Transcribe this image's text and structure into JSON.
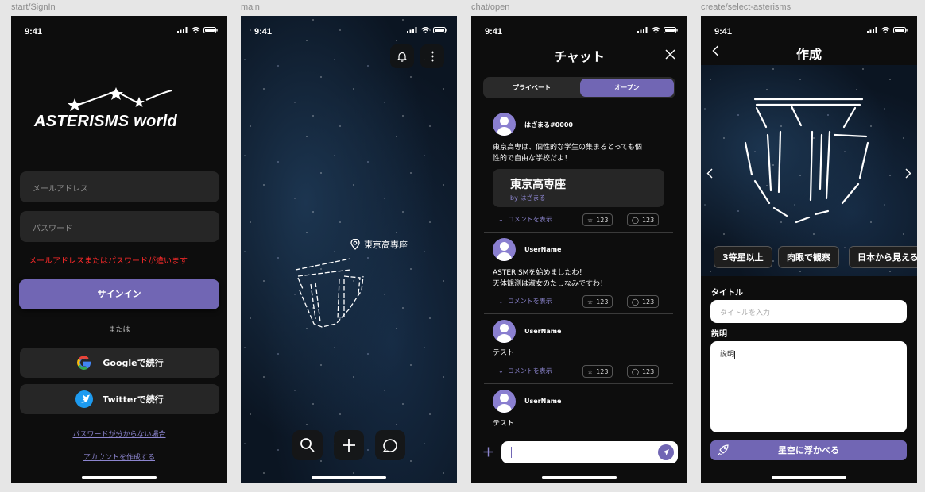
{
  "frames": [
    {
      "label": "start/SignIn"
    },
    {
      "label": "main"
    },
    {
      "label": "chat/open"
    },
    {
      "label": "create/select-asterisms"
    }
  ],
  "status_time": "9:41",
  "signin": {
    "logo_text": "ASTERISMS world",
    "email_placeholder": "メールアドレス",
    "password_placeholder": "パスワード",
    "error_text": "メールアドレスまたはパスワードが違います",
    "signin_label": "サインイン",
    "or_text": "または",
    "google_label": "Googleで続行",
    "twitter_label": "Twitterで続行",
    "forgot_link": "パスワードが分からない場合",
    "create_account_link": "アカウントを作成する"
  },
  "main": {
    "place_name": "東京高専座"
  },
  "chat": {
    "title": "チャット",
    "tabs": [
      "プライベート",
      "オープン"
    ],
    "active_tab": "オープン",
    "posts": [
      {
        "user": "はざまる#0000",
        "text_lines": [
          "東京高専は、個性的な学生の集まるとっても個",
          "性的で自由な学校だよ！"
        ],
        "card_title": "東京高専座",
        "card_by": "by はざまる",
        "comment_label": "コメントを表示",
        "stars": "123",
        "comments": "123"
      },
      {
        "user": "UserName",
        "text_lines": [
          "ASTERISMを始めましたわ！",
          "天体観測は淑女のたしなみですわ！"
        ],
        "comment_label": "コメントを表示",
        "stars": "123",
        "comments": "123"
      },
      {
        "user": "UserName",
        "text_lines": [
          "テスト"
        ],
        "comment_label": "コメントを表示",
        "stars": "123",
        "comments": "123"
      },
      {
        "user": "UserName",
        "text_lines": [
          "テスト"
        ]
      }
    ]
  },
  "create": {
    "title": "作成",
    "tags": [
      "3等星以上",
      "肉眼で観察",
      "日本から見える"
    ],
    "title_label": "タイトル",
    "title_placeholder": "タイトルを入力",
    "desc_label": "説明",
    "desc_value": "説明",
    "float_button": "星空に浮かべる"
  },
  "colors": {
    "accent": "#7166b4",
    "link": "#8c85cf",
    "error": "#ff2a2a",
    "surface": "#262626",
    "background": "#0d0d0d"
  }
}
